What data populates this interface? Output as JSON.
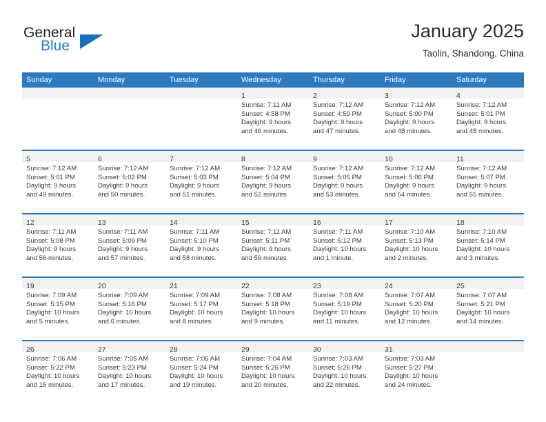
{
  "brand": {
    "name_part1": "General",
    "name_part2": "Blue",
    "logo_icon": "triangle-logo-icon"
  },
  "header": {
    "title": "January 2025",
    "location": "Taolin, Shandong, China"
  },
  "colors": {
    "header_blue": "#2e7ac0",
    "brand_blue": "#2079c7",
    "daynum_band": "#f2f2f2",
    "text": "#3b3b3b"
  },
  "weekday_headers": [
    "Sunday",
    "Monday",
    "Tuesday",
    "Wednesday",
    "Thursday",
    "Friday",
    "Saturday"
  ],
  "weeks": [
    [
      {
        "day": "",
        "lines": []
      },
      {
        "day": "",
        "lines": []
      },
      {
        "day": "",
        "lines": []
      },
      {
        "day": "1",
        "lines": [
          "Sunrise: 7:11 AM",
          "Sunset: 4:58 PM",
          "Daylight: 9 hours",
          "and 46 minutes."
        ]
      },
      {
        "day": "2",
        "lines": [
          "Sunrise: 7:12 AM",
          "Sunset: 4:59 PM",
          "Daylight: 9 hours",
          "and 47 minutes."
        ]
      },
      {
        "day": "3",
        "lines": [
          "Sunrise: 7:12 AM",
          "Sunset: 5:00 PM",
          "Daylight: 9 hours",
          "and 48 minutes."
        ]
      },
      {
        "day": "4",
        "lines": [
          "Sunrise: 7:12 AM",
          "Sunset: 5:01 PM",
          "Daylight: 9 hours",
          "and 48 minutes."
        ]
      }
    ],
    [
      {
        "day": "5",
        "lines": [
          "Sunrise: 7:12 AM",
          "Sunset: 5:01 PM",
          "Daylight: 9 hours",
          "and 49 minutes."
        ]
      },
      {
        "day": "6",
        "lines": [
          "Sunrise: 7:12 AM",
          "Sunset: 5:02 PM",
          "Daylight: 9 hours",
          "and 50 minutes."
        ]
      },
      {
        "day": "7",
        "lines": [
          "Sunrise: 7:12 AM",
          "Sunset: 5:03 PM",
          "Daylight: 9 hours",
          "and 51 minutes."
        ]
      },
      {
        "day": "8",
        "lines": [
          "Sunrise: 7:12 AM",
          "Sunset: 5:04 PM",
          "Daylight: 9 hours",
          "and 52 minutes."
        ]
      },
      {
        "day": "9",
        "lines": [
          "Sunrise: 7:12 AM",
          "Sunset: 5:05 PM",
          "Daylight: 9 hours",
          "and 53 minutes."
        ]
      },
      {
        "day": "10",
        "lines": [
          "Sunrise: 7:12 AM",
          "Sunset: 5:06 PM",
          "Daylight: 9 hours",
          "and 54 minutes."
        ]
      },
      {
        "day": "11",
        "lines": [
          "Sunrise: 7:12 AM",
          "Sunset: 5:07 PM",
          "Daylight: 9 hours",
          "and 55 minutes."
        ]
      }
    ],
    [
      {
        "day": "12",
        "lines": [
          "Sunrise: 7:11 AM",
          "Sunset: 5:08 PM",
          "Daylight: 9 hours",
          "and 56 minutes."
        ]
      },
      {
        "day": "13",
        "lines": [
          "Sunrise: 7:11 AM",
          "Sunset: 5:09 PM",
          "Daylight: 9 hours",
          "and 57 minutes."
        ]
      },
      {
        "day": "14",
        "lines": [
          "Sunrise: 7:11 AM",
          "Sunset: 5:10 PM",
          "Daylight: 9 hours",
          "and 58 minutes."
        ]
      },
      {
        "day": "15",
        "lines": [
          "Sunrise: 7:11 AM",
          "Sunset: 5:11 PM",
          "Daylight: 9 hours",
          "and 59 minutes."
        ]
      },
      {
        "day": "16",
        "lines": [
          "Sunrise: 7:11 AM",
          "Sunset: 5:12 PM",
          "Daylight: 10 hours",
          "and 1 minute."
        ]
      },
      {
        "day": "17",
        "lines": [
          "Sunrise: 7:10 AM",
          "Sunset: 5:13 PM",
          "Daylight: 10 hours",
          "and 2 minutes."
        ]
      },
      {
        "day": "18",
        "lines": [
          "Sunrise: 7:10 AM",
          "Sunset: 5:14 PM",
          "Daylight: 10 hours",
          "and 3 minutes."
        ]
      }
    ],
    [
      {
        "day": "19",
        "lines": [
          "Sunrise: 7:09 AM",
          "Sunset: 5:15 PM",
          "Daylight: 10 hours",
          "and 5 minutes."
        ]
      },
      {
        "day": "20",
        "lines": [
          "Sunrise: 7:09 AM",
          "Sunset: 5:16 PM",
          "Daylight: 10 hours",
          "and 6 minutes."
        ]
      },
      {
        "day": "21",
        "lines": [
          "Sunrise: 7:09 AM",
          "Sunset: 5:17 PM",
          "Daylight: 10 hours",
          "and 8 minutes."
        ]
      },
      {
        "day": "22",
        "lines": [
          "Sunrise: 7:08 AM",
          "Sunset: 5:18 PM",
          "Daylight: 10 hours",
          "and 9 minutes."
        ]
      },
      {
        "day": "23",
        "lines": [
          "Sunrise: 7:08 AM",
          "Sunset: 5:19 PM",
          "Daylight: 10 hours",
          "and 11 minutes."
        ]
      },
      {
        "day": "24",
        "lines": [
          "Sunrise: 7:07 AM",
          "Sunset: 5:20 PM",
          "Daylight: 10 hours",
          "and 12 minutes."
        ]
      },
      {
        "day": "25",
        "lines": [
          "Sunrise: 7:07 AM",
          "Sunset: 5:21 PM",
          "Daylight: 10 hours",
          "and 14 minutes."
        ]
      }
    ],
    [
      {
        "day": "26",
        "lines": [
          "Sunrise: 7:06 AM",
          "Sunset: 5:22 PM",
          "Daylight: 10 hours",
          "and 15 minutes."
        ]
      },
      {
        "day": "27",
        "lines": [
          "Sunrise: 7:05 AM",
          "Sunset: 5:23 PM",
          "Daylight: 10 hours",
          "and 17 minutes."
        ]
      },
      {
        "day": "28",
        "lines": [
          "Sunrise: 7:05 AM",
          "Sunset: 5:24 PM",
          "Daylight: 10 hours",
          "and 19 minutes."
        ]
      },
      {
        "day": "29",
        "lines": [
          "Sunrise: 7:04 AM",
          "Sunset: 5:25 PM",
          "Daylight: 10 hours",
          "and 20 minutes."
        ]
      },
      {
        "day": "30",
        "lines": [
          "Sunrise: 7:03 AM",
          "Sunset: 5:26 PM",
          "Daylight: 10 hours",
          "and 22 minutes."
        ]
      },
      {
        "day": "31",
        "lines": [
          "Sunrise: 7:03 AM",
          "Sunset: 5:27 PM",
          "Daylight: 10 hours",
          "and 24 minutes."
        ]
      },
      {
        "day": "",
        "lines": []
      }
    ]
  ]
}
